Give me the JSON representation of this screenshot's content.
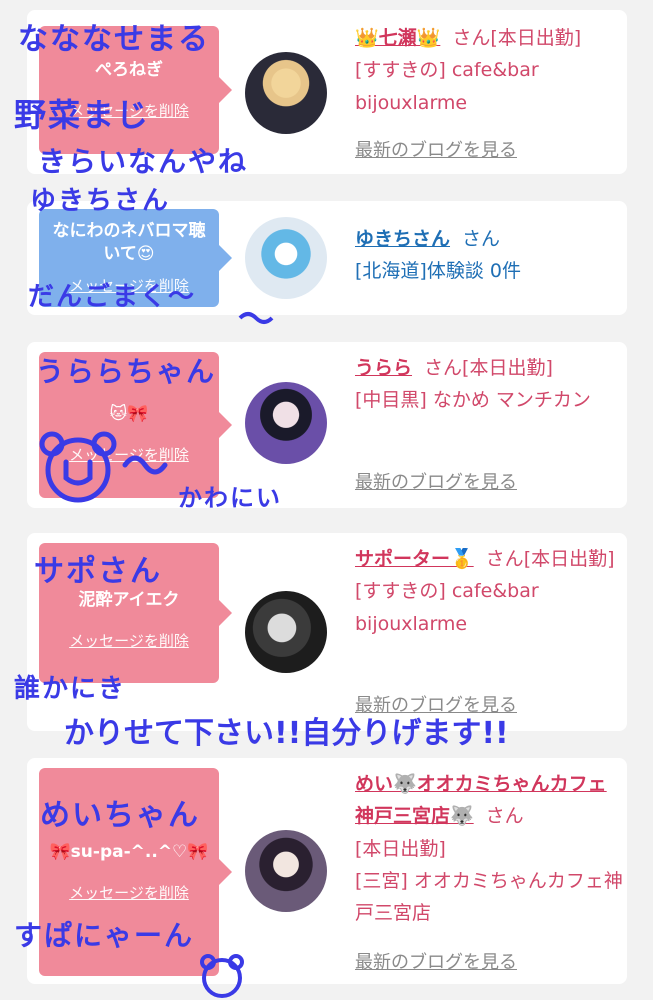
{
  "cards": [
    {
      "bubble_color": "#f08a9a",
      "message": "ぺろねぎ",
      "delete_label": "メッセージを削除",
      "name": "👑七瀬👑",
      "san": "さん",
      "status": "[本日出勤]",
      "store": "[すすきの] cafe&bar bijouxlarme",
      "blog_label": "最新のブログを見る"
    },
    {
      "bubble_color": "#7fb0ec",
      "message": "なにわのネバロマ聴いて😍",
      "delete_label": "メッセージを削除",
      "name": "ゆきちさん",
      "san": "さん",
      "store": "[北海道]体験談 0件"
    },
    {
      "bubble_color": "#f08a9a",
      "message": "🐱🎀",
      "delete_label": "メッセージを削除",
      "name": "うらら",
      "san": "さん",
      "status": "[本日出勤]",
      "store": "[中目黒] なかめ マンチカン",
      "blog_label": "最新のブログを見る"
    },
    {
      "bubble_color": "#f08a9a",
      "message": "泥酔アイエク",
      "delete_label": "メッセージを削除",
      "name": "サポーター🥇",
      "san": "さん",
      "status": "[本日出勤]",
      "store": "[すすきの] cafe&bar bijouxlarme",
      "blog_label": "最新のブログを見る"
    },
    {
      "bubble_color": "#f08a9a",
      "message": "🎀su-pa-^..^♡🎀",
      "delete_label": "メッセージを削除",
      "name": "めい🐺オオカミちゃんカフェ神戸三宮店🐺",
      "san": "さん",
      "status": "[本日出勤]",
      "store": "[三宮] オオカミちゃんカフェ神戸三宮店",
      "blog_label": "最新のブログを見る"
    }
  ],
  "handwriting": {
    "h1": "なななせまる",
    "h2": "野菜まじ",
    "h3": "きらいなんやね",
    "h4": "ゆきちさん",
    "h5": "だんごまく〜",
    "h6": "うららちゃん",
    "h7": "かわにい",
    "h8": "サポさん",
    "h9": "誰かにき",
    "h10": "かりせて下さい!!自分りげます!!",
    "h11": "めいちゃん",
    "h12": "すぱにゃーん"
  }
}
